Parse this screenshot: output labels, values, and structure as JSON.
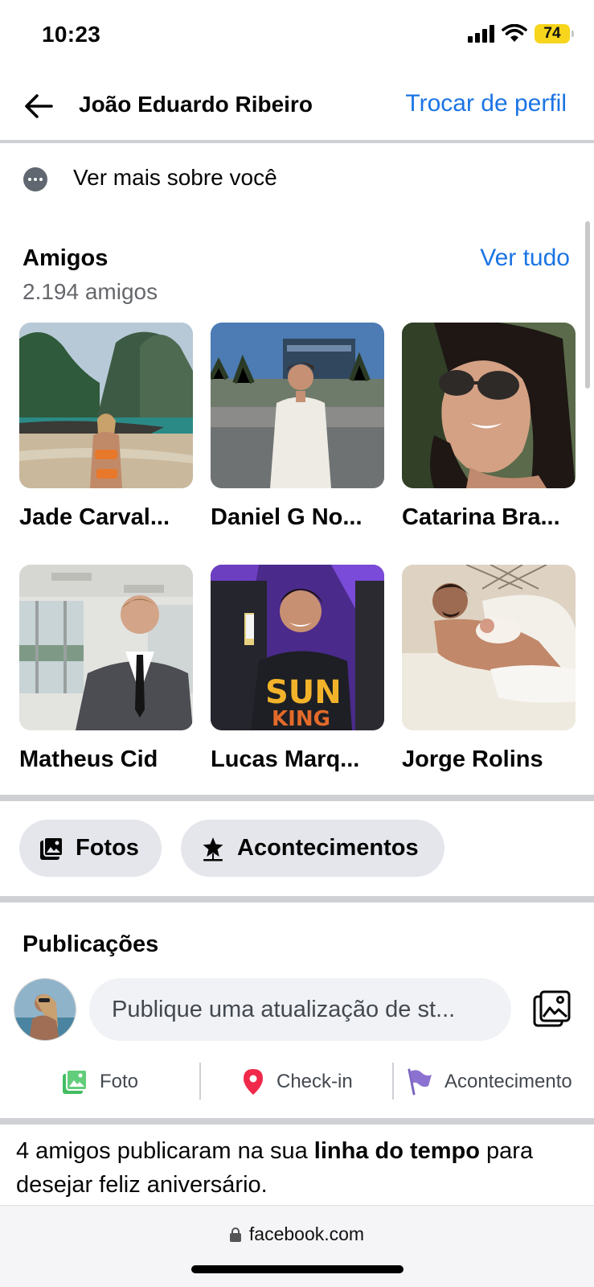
{
  "status_bar": {
    "time": "10:23",
    "battery": "74"
  },
  "header": {
    "title": "João Eduardo Ribeiro",
    "switch_profile": "Trocar de perfil"
  },
  "see_more": {
    "label": "Ver mais sobre você"
  },
  "friends": {
    "title": "Amigos",
    "count": "2.194 amigos",
    "see_all": "Ver tudo",
    "items": [
      {
        "name": "Jade Carval..."
      },
      {
        "name": "Daniel G No..."
      },
      {
        "name": "Catarina Bra..."
      },
      {
        "name": "Matheus Cid"
      },
      {
        "name": "Lucas Marq..."
      },
      {
        "name": "Jorge Rolins"
      }
    ]
  },
  "chips": {
    "photos": "Fotos",
    "events": "Acontecimentos"
  },
  "posts": {
    "title": "Publicações",
    "composer_placeholder": "Publique uma atualização de st...",
    "actions": {
      "photo": "Foto",
      "checkin": "Check-in",
      "event": "Acontecimento"
    }
  },
  "timeline": {
    "part1": "4 amigos publicaram na sua ",
    "bold": "linha do tempo",
    "part2": " para desejar feliz aniversário."
  },
  "browser": {
    "url": "facebook.com"
  },
  "colors": {
    "link": "#1b74e4",
    "chip_bg": "#e4e6eb",
    "divider": "#ced0d4",
    "battery": "#f6d51c"
  }
}
